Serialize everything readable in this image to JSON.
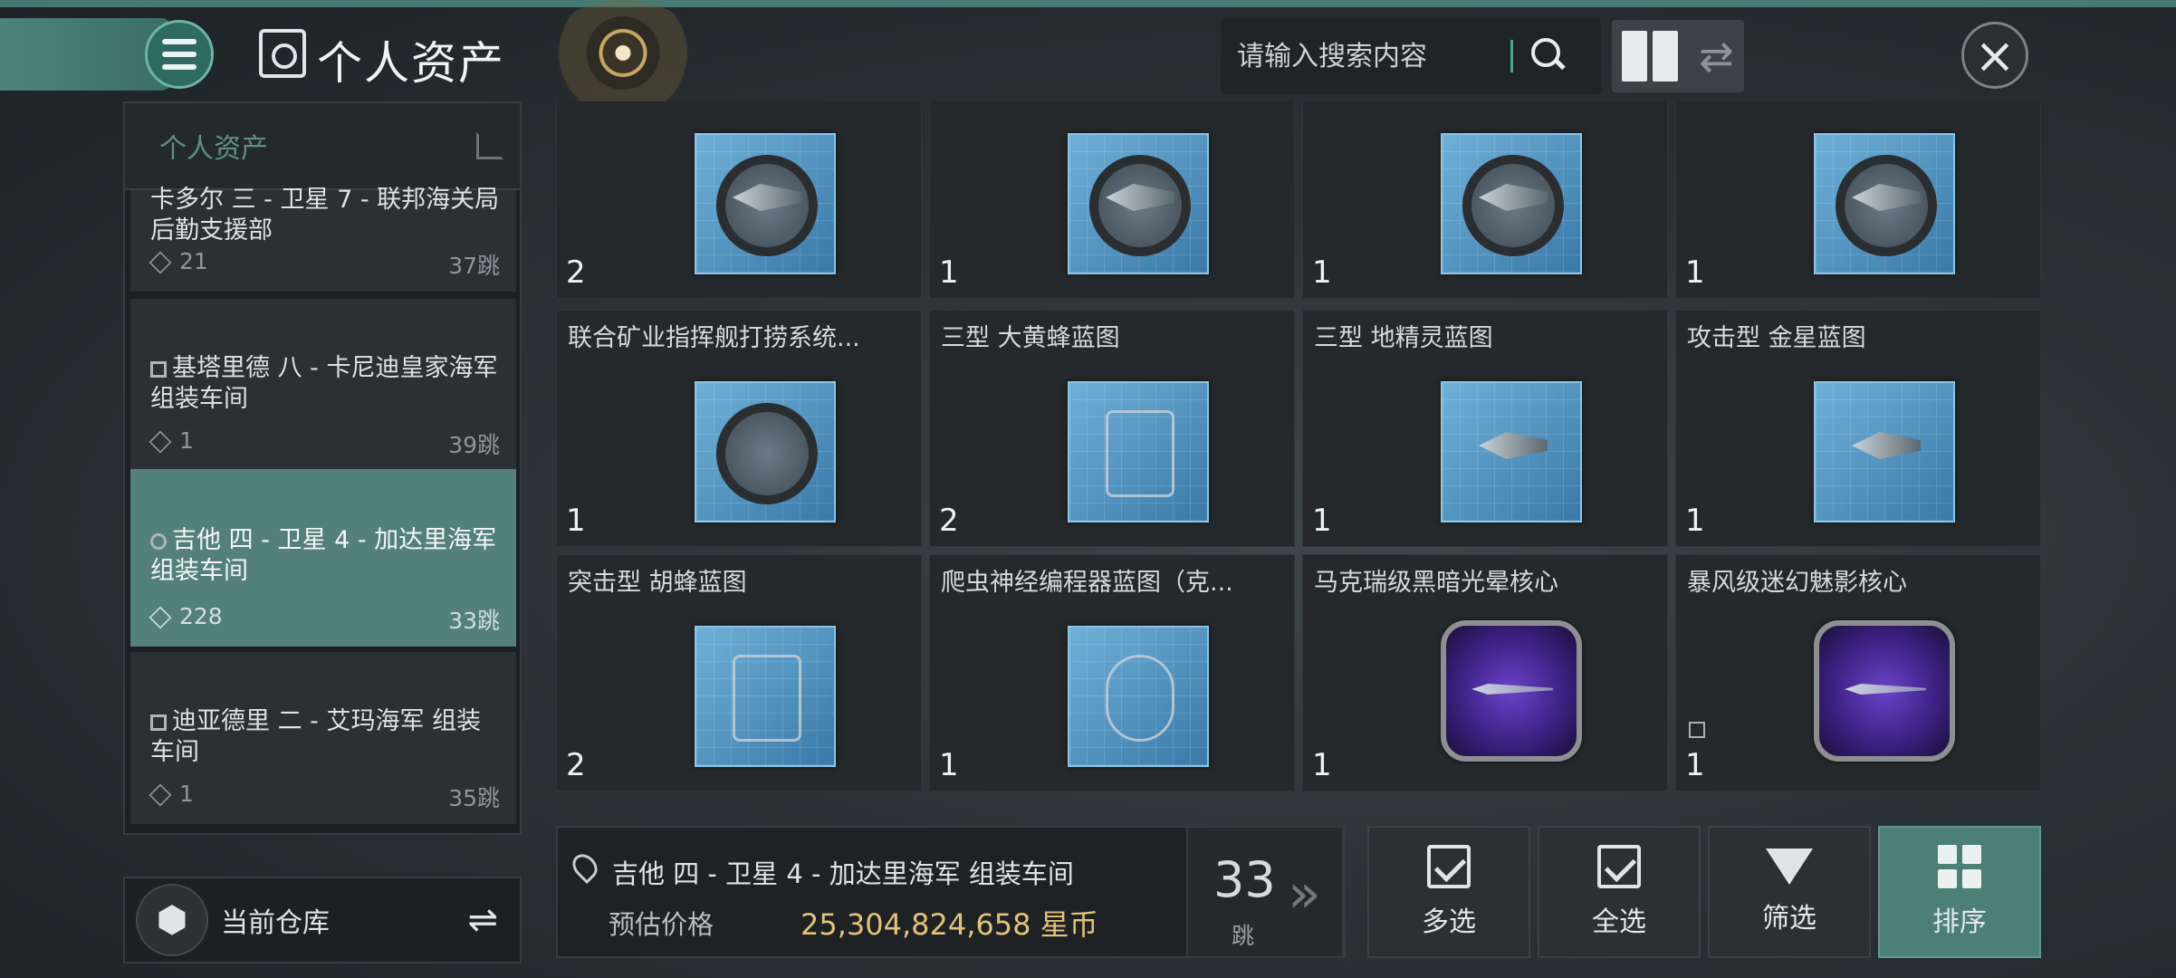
{
  "header": {
    "title": "个人资产",
    "search_placeholder": "请输入搜索内容"
  },
  "sidebar": {
    "title": "个人资产",
    "locations": [
      {
        "name": "卡多尔 三 - 卫星 7 - 联邦海关局 后勤支援部",
        "count": "21",
        "jumps": "37跳"
      },
      {
        "name": "基塔里德 八 - 卡尼迪皇家海军 组装车间",
        "count": "1",
        "jumps": "39跳"
      },
      {
        "name": "吉他 四 - 卫星 4 - 加达里海军 组装车间",
        "count": "228",
        "jumps": "33跳"
      },
      {
        "name": "迪亚德里 二 - 艾玛海军 组装车间",
        "count": "1",
        "jumps": "35跳"
      }
    ],
    "warehouse_label": "当前仓库"
  },
  "items": [
    {
      "name": "",
      "qty": "2"
    },
    {
      "name": "",
      "qty": "1"
    },
    {
      "name": "",
      "qty": "1"
    },
    {
      "name": "",
      "qty": "1"
    },
    {
      "name": "联合矿业指挥舰打捞系统...",
      "qty": "1"
    },
    {
      "name": "三型 大黄蜂蓝图",
      "qty": "2"
    },
    {
      "name": "三型 地精灵蓝图",
      "qty": "1"
    },
    {
      "name": "攻击型 金星蓝图",
      "qty": "1"
    },
    {
      "name": "突击型 胡蜂蓝图",
      "qty": "2"
    },
    {
      "name": "爬虫神经编程器蓝图（克...",
      "qty": "1"
    },
    {
      "name": "马克瑞级黑暗光晕核心",
      "qty": "1"
    },
    {
      "name": "暴风级迷幻魅影核心",
      "qty": "1"
    }
  ],
  "location_panel": {
    "name": "吉他 四 - 卫星 4 - 加达里海军 组装车间",
    "price_label": "预估价格",
    "price_value": "25,304,824,658 星币",
    "jumps": "33",
    "jumps_unit": "跳"
  },
  "actions": {
    "multi": "多选",
    "all": "全选",
    "filter": "筛选",
    "sort": "排序"
  },
  "colors": {
    "accent": "#4c7f76",
    "price": "#e3c27a"
  }
}
